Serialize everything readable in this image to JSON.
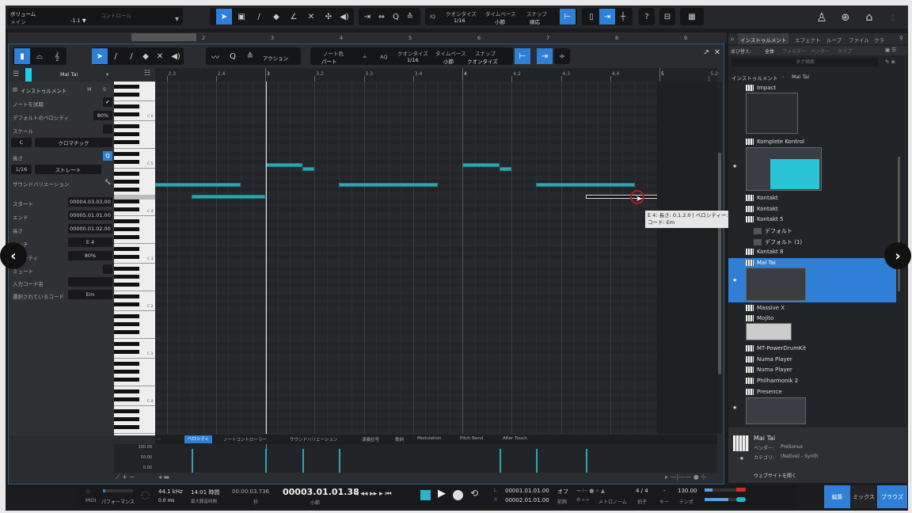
{
  "topbar": {
    "volume_label": "ボリューム",
    "track": "メイン",
    "volume_value": "-1.1 ▼",
    "control_label": "コントロール",
    "quantize_label": "クオンタイズ",
    "quantize_value": "1/16",
    "timebase_label": "タイムベース",
    "timebase_value": "小節",
    "snap_label": "スナップ",
    "snap_value": "順応",
    "iq": "IQ",
    "help": "?"
  },
  "arrange_ruler": [
    "2",
    "3",
    "4",
    "5",
    "6",
    "7",
    "8",
    "9"
  ],
  "editor": {
    "action_label": "アクション",
    "note_color_label": "ノート色",
    "note_color_value": "パート",
    "aq": "AQ",
    "quantize_label": "クオンタイズ",
    "quantize_value": "1/16",
    "timebase_label": "タイムベース",
    "timebase_value": "小節",
    "snap_label": "スナップ",
    "snap_value": "クオンタイズ",
    "track_name": "Mai Tai",
    "ruler": [
      {
        "label": "2.3",
        "bar": 2.5
      },
      {
        "label": "2.4",
        "bar": 2.75
      },
      {
        "label": "3",
        "bar": 3
      },
      {
        "label": "3.2",
        "bar": 3.25
      },
      {
        "label": "3.3",
        "bar": 3.5
      },
      {
        "label": "3.4",
        "bar": 3.75
      },
      {
        "label": "4",
        "bar": 4
      },
      {
        "label": "4.2",
        "bar": 4.25
      },
      {
        "label": "4.3",
        "bar": 4.5
      },
      {
        "label": "4.4",
        "bar": 4.75
      },
      {
        "label": "5",
        "bar": 5
      },
      {
        "label": "5.2",
        "bar": 5.25
      }
    ],
    "key_labels": [
      {
        "label": "C 6",
        "midi": 84
      },
      {
        "label": "C 5",
        "midi": 72
      },
      {
        "label": "C 4",
        "midi": 60
      },
      {
        "label": "C 3",
        "midi": 48
      },
      {
        "label": "C 2",
        "midi": 36
      },
      {
        "label": "C 1",
        "midi": 24
      },
      {
        "label": "C 0",
        "midi": 12
      }
    ],
    "playhead_bar": 3.005,
    "notes": [
      {
        "pitch": "C5",
        "midi": 72,
        "start": 3.0,
        "end": 3.1875
      },
      {
        "pitch": "B4",
        "midi": 71,
        "start": 3.1875,
        "end": 3.25
      },
      {
        "pitch": "G4",
        "midi": 67,
        "start": 2.375,
        "end": 2.875
      },
      {
        "pitch": "E4",
        "midi": 64,
        "start": 2.625,
        "end": 3.0
      },
      {
        "pitch": "G4",
        "midi": 67,
        "start": 3.375,
        "end": 3.875
      },
      {
        "pitch": "C5",
        "midi": 72,
        "start": 4.0,
        "end": 4.1875
      },
      {
        "pitch": "B4",
        "midi": 71,
        "start": 4.1875,
        "end": 4.25
      },
      {
        "pitch": "G4",
        "midi": 67,
        "start": 4.375,
        "end": 4.875
      },
      {
        "pitch": "E4",
        "midi": 64,
        "start": 4.625,
        "end": 5.0,
        "selected": true
      }
    ],
    "velocity_starts": [
      2.625,
      3.0,
      3.1875,
      3.375,
      4.1875,
      4.375,
      4.625
    ],
    "tooltip": {
      "line1": "E 4:  長さ: 0.1.2.0 | ベロシティー: 80.0%",
      "line2": "コード: Em"
    },
    "lane_tabs": [
      "...",
      "ベロシティ",
      "ノートコントローラー",
      "サウンドバリエーション",
      "演奏記号",
      "歌詞",
      "Modulation",
      "Pitch Bend",
      "After Touch"
    ],
    "lane_scale": [
      "100.00",
      "50.00",
      "0.00"
    ]
  },
  "inspector": {
    "instrument": "インストゥルメント",
    "m": "M",
    "s": "S",
    "audition": "ノートを試聴",
    "default_velocity_label": "デフォルトのベロシティ",
    "default_velocity": "80%",
    "scale": "スケール",
    "root": "C",
    "scale_type": "クロマチック",
    "length": "長さ",
    "length_value": "1/16",
    "length_type": "ストレート",
    "sound_variation": "サウンドバリエーション",
    "start_label": "スタート",
    "start": "00004.03.03.00",
    "end_label": "エンド",
    "end": "00005.01.01.00",
    "len_label": "長さ",
    "len": "00000.01.02.00",
    "pitch_label": "ピッチ",
    "pitch": "E 4",
    "velocity_label": "ベロシティ",
    "velocity": "80%",
    "mute_label": "ミュート",
    "chord_in_label": "入力コード名",
    "chord_sel_label": "選択されているコード",
    "chord_sel": "Em"
  },
  "browser": {
    "tabs": [
      "インストゥルメント",
      "エフェクト",
      "ループ",
      "ファイル",
      "クラ"
    ],
    "sort_label": "並び替え:",
    "sort": [
      "全体",
      "フォルダー",
      "ベンダー",
      "タイプ"
    ],
    "search_placeholder": "タグ検索",
    "breadcrumb": [
      "インストゥルメント",
      "Mai Tai"
    ],
    "items": [
      "Impact",
      "Komplete Kontrol",
      "Kontakt",
      "Kontakt",
      "Kontakt 5",
      "デフォルト",
      "デフォルト (1)",
      "Kontakt 8",
      "Mai Tai",
      "Massive X",
      "Mojito",
      "MT-PowerDrumKit",
      "Numa Player",
      "Numa Player",
      "Philharmonik 2",
      "Presence"
    ],
    "info": {
      "name": "Mai Tai",
      "vendor_label": "ベンダー:",
      "vendor": "PreSonus",
      "category_label": "カテゴリ:",
      "category": "(Native) - Synth",
      "website": "ウェブサイトを開く"
    }
  },
  "transport": {
    "midi": "MIDI",
    "performance": "パフォーマンス",
    "sample_rate": "44.1 kHz",
    "latency": "0.0 ms",
    "record_time": "14:01 時間",
    "record_time_label": "最大録音時間",
    "seconds": "00:00:03.736",
    "seconds_unit": "秒",
    "position": "00003.01.01.38",
    "position_unit": "小節",
    "loop_l": "00001.01.01.00",
    "loop_r": "00002.01.01.00",
    "l": "L",
    "r": "R",
    "punch": "オフ",
    "punch_label": "前飾",
    "metronome": "メトロノーム",
    "signature": "4 / 4",
    "signature_label": "拍子",
    "key": "-",
    "key_label": "キー",
    "tempo": "130.00",
    "tempo_label": "テンポ"
  },
  "pages": {
    "edit": "編集",
    "mix": "ミックス",
    "browse": "ブラウズ"
  },
  "colors": {
    "accent": "#2f7fd6",
    "note": "#2aa7b0",
    "track": "#19d3e6"
  }
}
